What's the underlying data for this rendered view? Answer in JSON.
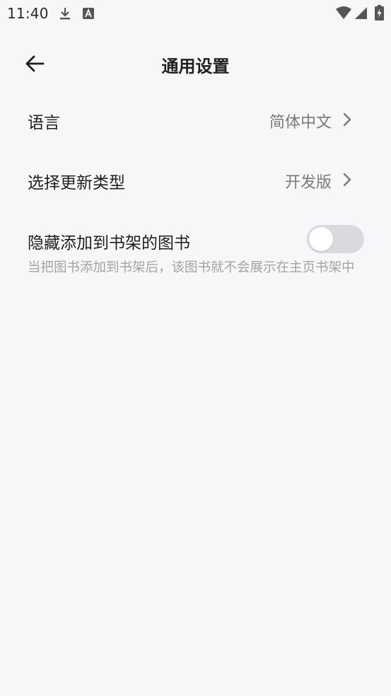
{
  "status_bar": {
    "time": "11:40",
    "icons": [
      "download-icon",
      "keyboard-a-icon",
      "wifi-icon",
      "signal-icon",
      "battery-charging-icon"
    ]
  },
  "app_bar": {
    "back_icon": "arrow-left-icon",
    "title": "通用设置"
  },
  "settings": {
    "language": {
      "label": "语言",
      "value": "简体中文",
      "icon": "chevron-right-icon"
    },
    "update_type": {
      "label": "选择更新类型",
      "value": "开发版",
      "icon": "chevron-right-icon"
    },
    "hide_books": {
      "label": "隐藏添加到书架的图书",
      "description": "当把图书添加到书架后，该图书就不会展示在主页书架中",
      "enabled": false
    }
  },
  "colors": {
    "background": "#f7f7f9",
    "text_primary": "#1f1f1f",
    "text_secondary": "#7a7a7a",
    "text_hint": "#a3a3a3",
    "toggle_off": "#d9d9de"
  }
}
